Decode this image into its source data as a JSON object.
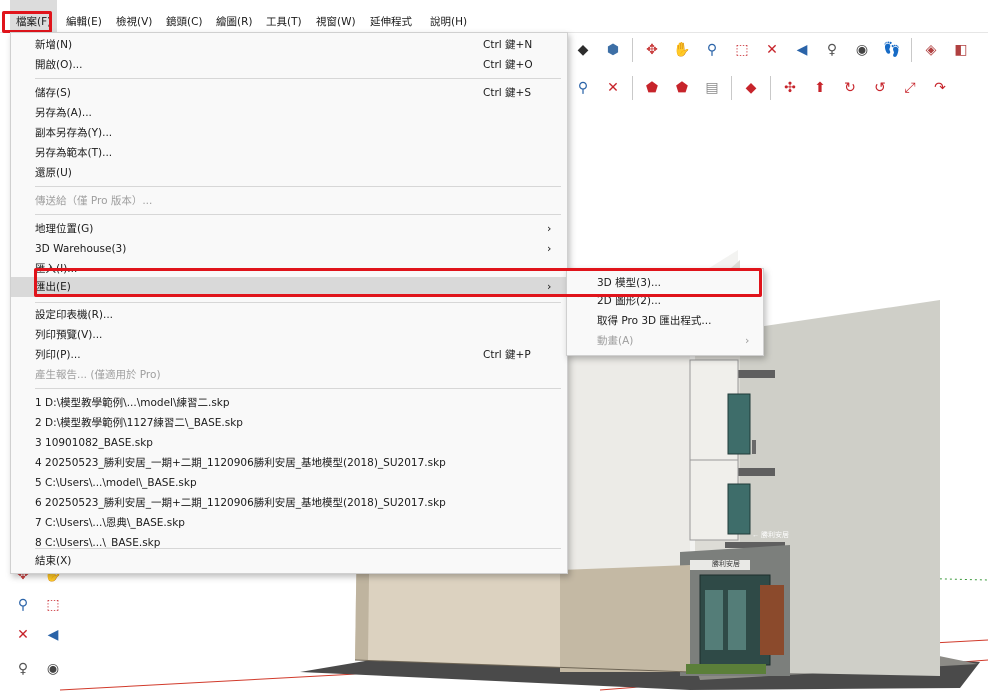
{
  "menubar": {
    "items": [
      {
        "label": "檔案(F)"
      },
      {
        "label": "編輯(E)"
      },
      {
        "label": "檢視(V)"
      },
      {
        "label": "鏡頭(C)"
      },
      {
        "label": "繪圖(R)"
      },
      {
        "label": "工具(T)"
      },
      {
        "label": "視窗(W)"
      },
      {
        "label": "延伸程式"
      },
      {
        "label": "說明(H)"
      }
    ]
  },
  "file_menu": {
    "new": {
      "label": "新增(N)",
      "shortcut": "Ctrl 鍵+N"
    },
    "open": {
      "label": "開啟(O)...",
      "shortcut": "Ctrl 鍵+O"
    },
    "save": {
      "label": "儲存(S)",
      "shortcut": "Ctrl 鍵+S"
    },
    "save_as": {
      "label": "另存為(A)..."
    },
    "save_copy_as": {
      "label": "副本另存為(Y)..."
    },
    "save_as_template": {
      "label": "另存為範本(T)..."
    },
    "revert": {
      "label": "還原(U)"
    },
    "send_to": {
      "label": "傳送給（僅 Pro 版本）..."
    },
    "geo_location": {
      "label": "地理位置(G)"
    },
    "warehouse": {
      "label": "3D Warehouse(3)"
    },
    "import": {
      "label": "匯入(I)..."
    },
    "export": {
      "label": "匯出(E)"
    },
    "printer_setup": {
      "label": "設定印表機(R)..."
    },
    "print_preview": {
      "label": "列印預覽(V)..."
    },
    "print": {
      "label": "列印(P)...",
      "shortcut": "Ctrl 鍵+P"
    },
    "report": {
      "label": "產生報告... (僅適用於 Pro)"
    },
    "recent": [
      "1 D:\\模型教學範例\\...\\model\\練習二.skp",
      "2 D:\\模型教學範例\\1127練習二\\_BASE.skp",
      "3 10901082_BASE.skp",
      "4 20250523_勝利安居_一期+二期_1120906勝利安居_基地模型(2018)_SU2017.skp",
      "5 C:\\Users\\...\\model\\_BASE.skp",
      "6 20250523_勝利安居_一期+二期_1120906勝利安居_基地模型(2018)_SU2017.skp",
      "7 C:\\Users\\...\\恩典\\_BASE.skp",
      "8 C:\\Users\\...\\_BASE.skp"
    ],
    "exit": {
      "label": "結束(X)"
    },
    "arrow": "›"
  },
  "export_submenu": {
    "model3d": "3D 模型(3)...",
    "graphic2d": "2D 圖形(2)...",
    "pro3d": "取得 Pro 3D 匯出程式...",
    "animation": "動畫(A)"
  },
  "building": {
    "sign_1": "← 勝利安居",
    "sign_2": "勝利安居"
  },
  "colors": {
    "highlight_red": "#e0141b",
    "menu_bg": "#f9f9f9",
    "selected_bg": "#d9d9d9"
  }
}
